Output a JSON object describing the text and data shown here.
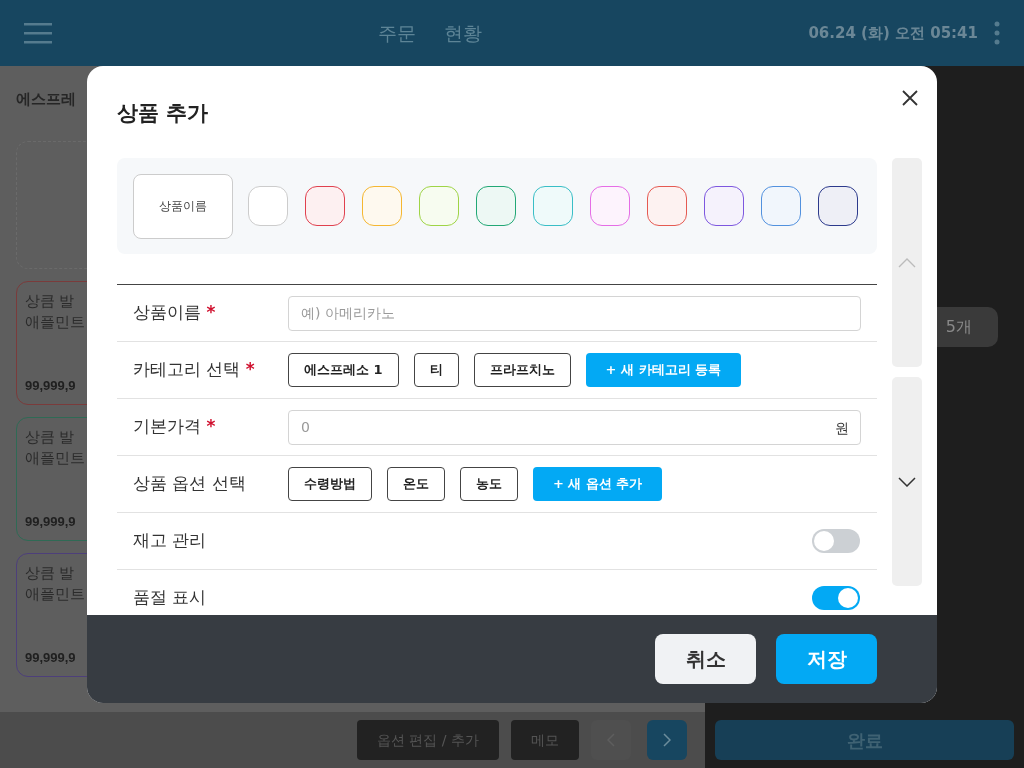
{
  "header": {
    "tabs": [
      {
        "label": "주문",
        "selected": false
      },
      {
        "label": "현황",
        "selected": false
      }
    ],
    "datetime": "06.24 (화) 오전 05:41"
  },
  "background": {
    "category": "에스프레",
    "cards": [
      {
        "line1": "상큼 발",
        "line2": "애플민트",
        "price": "99,999,9",
        "color": "#7a3b3b"
      },
      {
        "line1": "상큼 발",
        "line2": "애플민트",
        "price": "99,999,9",
        "color": "#2f6a55"
      },
      {
        "line1": "상큼 발",
        "line2": "애플민트",
        "price": "99,999,9",
        "color": "#4d3f7a"
      }
    ],
    "count_button": "5개",
    "bottom_buttons": [
      "옵션 편집 / 추가",
      "메모"
    ],
    "done_button": "완료"
  },
  "modal": {
    "title": "상품 추가",
    "preview": {
      "label": "상품이름"
    },
    "swatches": [
      {
        "color": "#cccccc",
        "selected": false
      },
      {
        "color": "#e0404e",
        "selected": false
      },
      {
        "color": "#f5b731",
        "selected": false
      },
      {
        "color": "#9fd446",
        "selected": false
      },
      {
        "color": "#22a775",
        "selected": false
      },
      {
        "color": "#39bec6",
        "selected": false
      },
      {
        "color": "#e56de6",
        "selected": false
      },
      {
        "color": "#e55a52",
        "selected": false
      },
      {
        "color": "#7d57df",
        "selected": false
      },
      {
        "color": "#5291de",
        "selected": false
      },
      {
        "color": "#2c3a8c",
        "selected": false
      }
    ],
    "rows": [
      {
        "kind": "input",
        "label": "상품이름",
        "required_mark": "*",
        "placeholder": "예) 아메리카노"
      },
      {
        "kind": "chips",
        "label": "카테고리 선택",
        "required_mark": "*",
        "chips": [
          "에스프레소 1",
          "티",
          "프라프치노"
        ],
        "add_button": "+ 새 카테고리 등록"
      },
      {
        "kind": "input",
        "label": "기본가격",
        "required_mark": "*",
        "placeholder": "0",
        "suffix": "원"
      },
      {
        "kind": "chips",
        "label": "상품 옵션 선택",
        "chips": [
          "수령방법",
          "온도",
          "농도"
        ],
        "add_button": "+ 새 옵션 추가"
      },
      {
        "kind": "toggle",
        "label": "재고 관리",
        "on": false
      },
      {
        "kind": "toggle",
        "label": "품절 표시",
        "on": true
      }
    ],
    "cancel_button": "취소",
    "save_button": "저장"
  }
}
